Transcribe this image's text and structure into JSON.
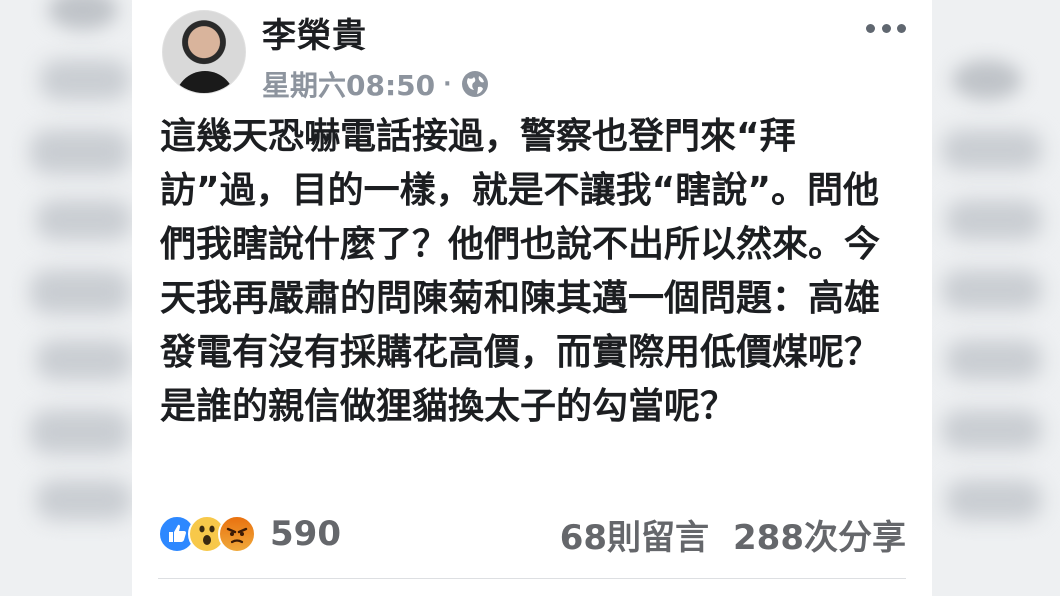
{
  "post": {
    "author": "李榮貴",
    "timestamp": "星期六08:50",
    "separator": "·",
    "privacy_icon": "globe-icon",
    "more_icon": "more-options-icon",
    "text": "這幾天恐嚇電話接過，警察也登門來“拜訪”過，目的一樣，就是不讓我“瞎說”。問他們我瞎說什麼了？他們也說不出所以然來。今天我再嚴肅的問陳菊和陳其邁一個問題：高雄發電有沒有採購花高價，而實際用低價煤呢？是誰的親信做狸貓換太子的勾當呢？"
  },
  "footer": {
    "reaction_icons": [
      "like-icon",
      "wow-icon",
      "angry-icon"
    ],
    "reaction_count": "590",
    "comments": "68則留言",
    "shares": "288次分享"
  },
  "colors": {
    "like": "#2d88ff",
    "wow": "#f7c84a",
    "angry": "#e9710f",
    "meta_text": "#8d949e"
  }
}
